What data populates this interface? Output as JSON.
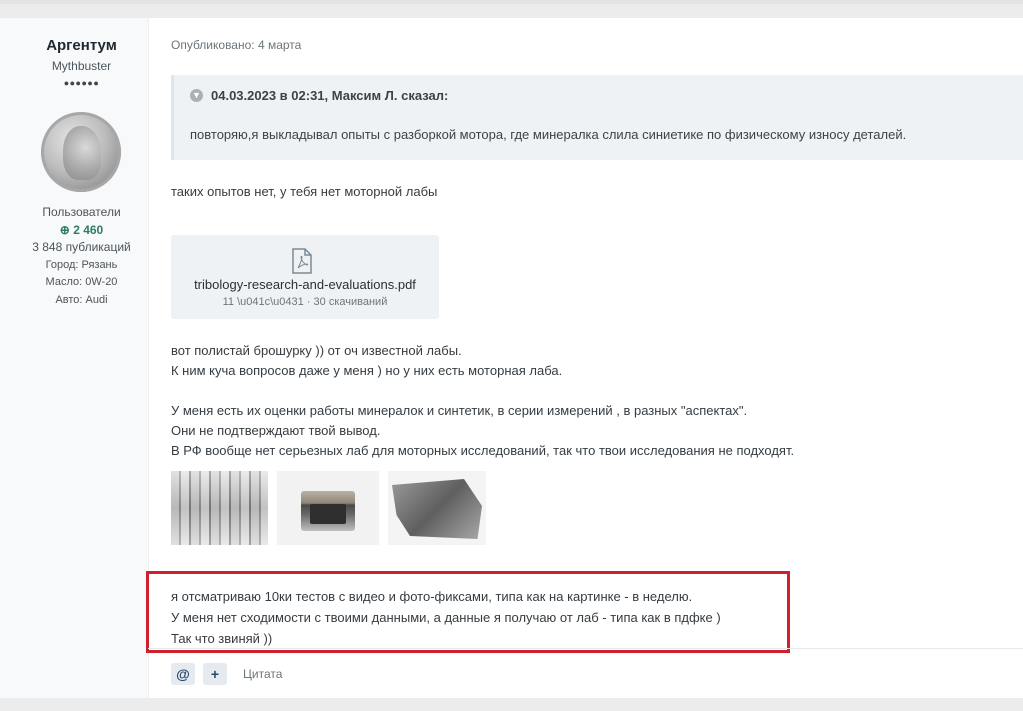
{
  "author": {
    "name": "Аргентум",
    "title": "Mythbuster",
    "rank_dots": "●●●●●●",
    "group": "Пользователи",
    "reputation": "2 460",
    "posts": "3 848 публикаций",
    "city": "Город: Рязань",
    "oil": "Масло: 0W-20",
    "car": "Авто: Audi"
  },
  "post": {
    "published": "Опубликовано: 4 марта",
    "quote_header": "04.03.2023 в 02:31, Максим Л. сказал:",
    "quote_body": "повторяю,я выкладывал опыты с разборкой мотора, где минералка слила синиетике по физическому износу деталей.",
    "reply_line": "таких опытов нет, у тебя нет моторной лабы",
    "attachment": {
      "file_name": "tribology-research-and-evaluations.pdf",
      "file_meta": "11 \\u041c\\u0431 · 30 скачиваний"
    },
    "paragraphs": [
      "вот полистай брошурку )) от оч известной лабы.",
      "К ним куча вопросов даже у меня ) но у них есть моторная лаба.",
      "",
      "У меня есть их оценки работы минералок и синтетик, в серии измерений , в разных \"аспектах\".",
      "Они не подтверждают твой вывод.",
      "В РФ вообще нет серьезных лаб для моторных исследований, так что твои исследования не подходят."
    ],
    "highlighted": [
      "я отсматриваю 10ки тестов с видео и фото-фиксами, типа как на картинке - в неделю.",
      "У меня нет сходимости с твоими данными, а данные я получаю от лаб - типа как в пдфке )",
      "Так что звиняй ))"
    ],
    "actions": {
      "mention": "@",
      "add": "+",
      "quote": "Цитата"
    }
  },
  "icons": [
    "chevron-down-icon",
    "pdf-file-icon",
    "plus-circle-icon"
  ],
  "colors": {
    "highlight_border": "#d0202d",
    "reputation": "#2e7d62"
  }
}
